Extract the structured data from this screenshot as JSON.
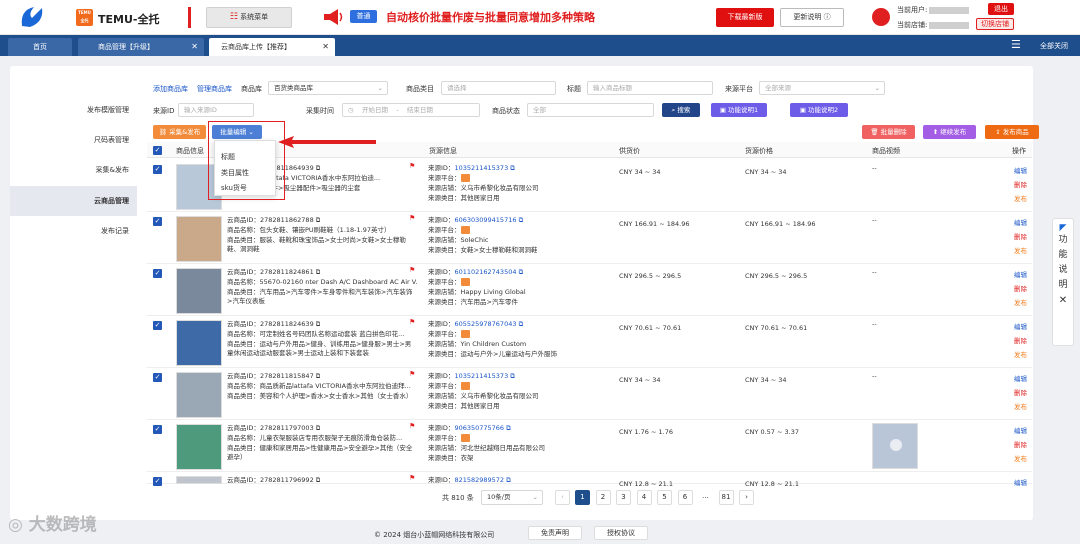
{
  "header": {
    "brand": "TEMU-全托",
    "brand_box": "TEMU\n全托",
    "menu_btn": "系统菜单",
    "notice_tag": "普通",
    "notice": "自动核价批量作废与批量同意增加多种策略",
    "download_btn": "下载最新版",
    "update_btn": "更新说明",
    "user_label": "当前用户:",
    "shop_label": "当前店铺:",
    "logout": "退出",
    "switch_shop": "切换店铺"
  },
  "tabs": {
    "home": "首页",
    "goods": "商品管理【升级】",
    "cloud": "云商品库上传【推荐】",
    "close_all": "全部关闭"
  },
  "sidebar": {
    "items": [
      "发布模版管理",
      "尺码表管理",
      "采集&发布",
      "云商品管理",
      "发布记录"
    ]
  },
  "filters": {
    "add_goods": "添加商品库",
    "manage_goods": "管理商品库",
    "lib_label": "商品库",
    "lib_value": "百货类商品库",
    "cat_label": "商品类目",
    "cat_ph": "请选择",
    "title_label": "标题",
    "title_ph": "输入商品标题",
    "platform_label": "来源平台",
    "platform_ph": "全部来源",
    "srcid_label": "来源ID",
    "srcid_ph": "输入来源ID",
    "time_label": "采集时间",
    "start_ph": "开始日期",
    "dash": "-",
    "end_ph": "结束日期",
    "status_label": "商品状态",
    "status_ph": "全部",
    "search_btn": "搜索",
    "help1": "功能说明1",
    "help2": "功能说明2"
  },
  "actions": {
    "collect": "采集&发布",
    "batch_edit": "批量编辑",
    "batch_delete": "批量删除",
    "continue_publish": "继续发布",
    "publish_goods": "发布商品"
  },
  "dropdown": [
    "标题",
    "类目属性",
    "sku货号"
  ],
  "columns": {
    "info": "商品信息",
    "source": "货源信息",
    "supply": "供货价",
    "source_price": "货源价格",
    "video": "商品视频",
    "op": "操作"
  },
  "ops": {
    "edit": "编辑",
    "delete": "删除",
    "publish": "发布"
  },
  "rows": [
    {
      "cid": "2782811864939",
      "l2": "11商品质新品lattafa VICTORIA香水中东阿拉伯迪...",
      "l3": "家居>大家电配件>吸尘器配件>吸尘器的尘套",
      "sid": "1035211415373",
      "shop": "义乌市希黎化妆品有限公司",
      "scat": "其他居家日用",
      "supply": "CNY 34 ~ 34",
      "sprice": "CNY 34 ~ 34",
      "video": "--"
    },
    {
      "cid": "2782811862788",
      "l2": "商品名称：包头女鞋、镶嵌PU刷鞋鞋（1.18-1.97英寸）",
      "l3": "商品类目：服装、鞋靴和珠宝饰品>女士时尚>女鞋>女士穆勒鞋、洞洞鞋",
      "sid": "606303099415716",
      "shop": "SoleChic",
      "scat": "女鞋>女士穆勒鞋和洞洞鞋",
      "supply": "CNY 166.91 ~ 184.96",
      "sprice": "CNY 166.91 ~ 184.96",
      "video": "--"
    },
    {
      "cid": "2782811824861",
      "l2": "商品名称：55670-02160 nter Dash A/C Dashboard AC Air V...",
      "l3": "商品类目：汽车用品>汽车零件>车身零件和汽车装饰>汽车装饰>汽车仪表板",
      "sid": "601102162743504",
      "shop": "Happy Living Global",
      "scat": "汽车用品>汽车零件",
      "supply": "CNY 296.5 ~ 296.5",
      "sprice": "CNY 296.5 ~ 296.5",
      "video": "--"
    },
    {
      "cid": "2782811824639",
      "l2": "商品名称：可定制姓名号码团队名称运动套装 蓝白拼色印花...",
      "l3": "商品类目：运动与户外用品>健身、训练用品>健身服>男士>男童休闲运动运动服套装>男士运动上装和下装套装",
      "sid": "605525978767043",
      "shop": "Yin Children Custom",
      "scat": "运动与户外>儿童运动与户外服饰",
      "supply": "CNY 70.61 ~ 70.61",
      "sprice": "CNY 70.61 ~ 70.61",
      "video": "--"
    },
    {
      "cid": "2782811815847",
      "l2": "商品名称：商品质新品lattafa VICTORIA香水中东阿拉伯迪拜...",
      "l3": "商品类目：美容和个人护理>香水>女士香水>其他（女士香水）",
      "sid": "1035211415373",
      "shop": "义乌市希黎化妆品有限公司",
      "scat": "其他居家日用",
      "supply": "CNY 34 ~ 34",
      "sprice": "CNY 34 ~ 34",
      "video": "--"
    },
    {
      "cid": "2782811797003",
      "l2": "商品名称：儿童衣架服装店专用衣服架子无痕防滑角仓装防...",
      "l3": "商品类目：健康和家居用品>性健康用品>安全避孕>其他（安全避孕）",
      "sid": "906350775766",
      "shop": "河北世纪越翔日用品有限公司",
      "scat": "衣架",
      "supply": "CNY 1.76 ~ 1.76",
      "sprice": "CNY 0.57 ~ 3.37",
      "video": ""
    },
    {
      "cid": "2782811796992",
      "sid": "821582989572",
      "supply": "CNY 12.8 ~ 21.1",
      "sprice": "CNY 12.8 ~ 21.1"
    }
  ],
  "labels": {
    "cloud_id": "云商品ID：",
    "name": "商品名称：",
    "category": "商品类目：",
    "source_id": "来源ID：",
    "source_platform": "来源平台：",
    "source_shop": "来源店铺：",
    "source_cat": "来源类目："
  },
  "pagination": {
    "total": "共 810 条",
    "per_page": "10条/页",
    "pages": [
      "1",
      "2",
      "3",
      "4",
      "5",
      "6",
      "...",
      "81"
    ],
    "prev": "‹",
    "next": "›"
  },
  "footer": {
    "copyright": "© 2024 烟台小蓝帽网络科技有限公司",
    "disclaimer": "免责声明",
    "agreement": "授权协议"
  },
  "float_help": [
    "功",
    "能",
    "说",
    "明"
  ],
  "watermark": "大数跨境",
  "colors": {
    "navy": "#1f4e8c",
    "red": "#e02020",
    "link": "#1a56c8",
    "orange": "#f28c3a"
  }
}
